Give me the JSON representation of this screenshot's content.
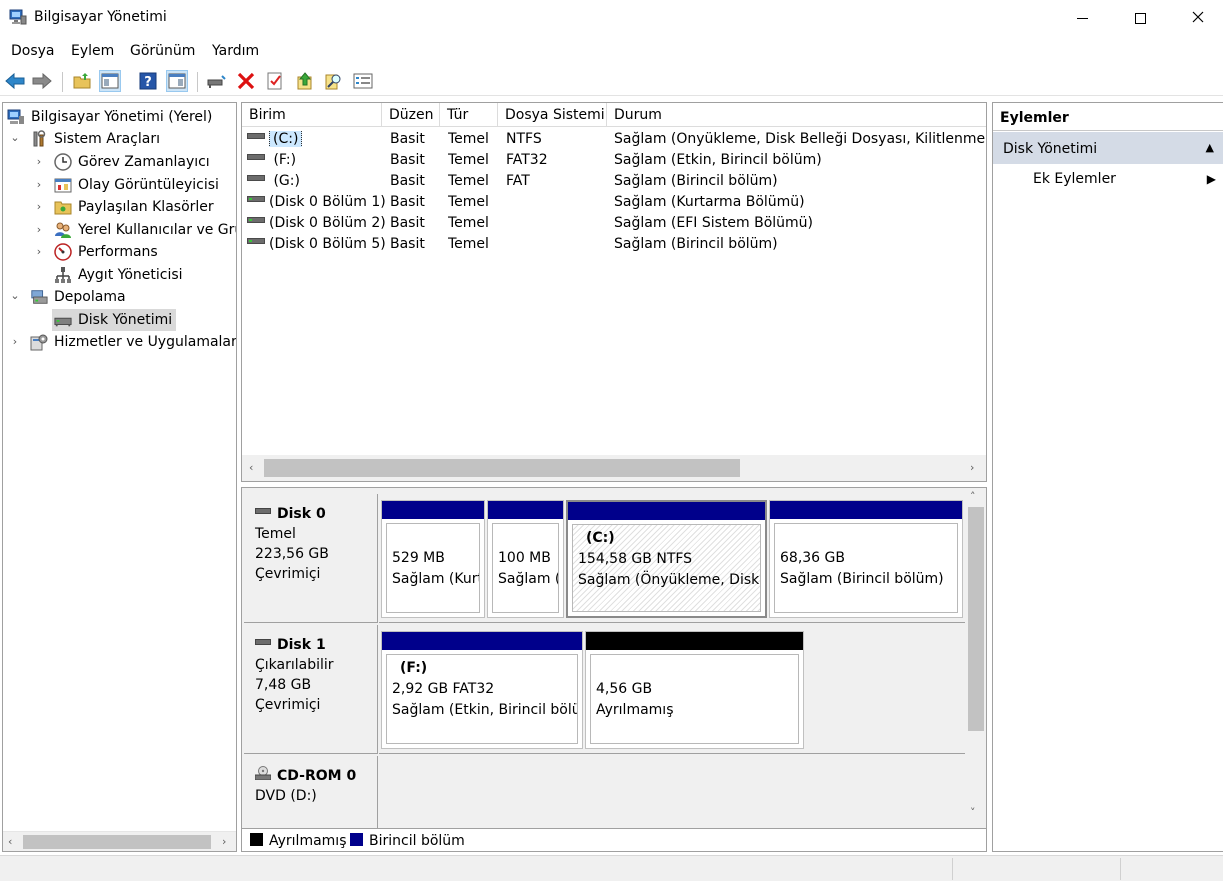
{
  "window": {
    "title": "Bilgisayar Yönetimi",
    "minimize": "—",
    "maximize": "☐",
    "close": "✕"
  },
  "menu": [
    "Dosya",
    "Eylem",
    "Görünüm",
    "Yardım"
  ],
  "tree": {
    "root": "Bilgisayar Yönetimi (Yerel)",
    "system_tools": "Sistem Araçları",
    "task_scheduler": "Görev Zamanlayıcı",
    "event_viewer": "Olay Görüntüleyicisi",
    "shared_folders": "Paylaşılan Klasörler",
    "local_users": "Yerel Kullanıcılar ve Gruplar",
    "performance": "Performans",
    "device_manager": "Aygıt Yöneticisi",
    "storage": "Depolama",
    "disk_management": "Disk Yönetimi",
    "services": "Hizmetler ve Uygulamalar"
  },
  "list": {
    "columns": [
      "Birim",
      "Düzen",
      "Tür",
      "Dosya Sistemi",
      "Durum"
    ],
    "rows": [
      {
        "birim": "(C:)",
        "duzen": "Basit",
        "tur": "Temel",
        "fs": "NTFS",
        "durum": "Sağlam (Önyükleme, Disk Belleği Dosyası, Kilitlenme Bilgi Dökümü, Birincil bölüm)"
      },
      {
        "birim": "(F:)",
        "duzen": "Basit",
        "tur": "Temel",
        "fs": "FAT32",
        "durum": "Sağlam (Etkin, Birincil bölüm)"
      },
      {
        "birim": "(G:)",
        "duzen": "Basit",
        "tur": "Temel",
        "fs": "FAT",
        "durum": "Sağlam (Birincil bölüm)"
      },
      {
        "birim": "(Disk 0 Bölüm 1)",
        "duzen": "Basit",
        "tur": "Temel",
        "fs": "",
        "durum": "Sağlam (Kurtarma Bölümü)"
      },
      {
        "birim": "(Disk 0 Bölüm 2)",
        "duzen": "Basit",
        "tur": "Temel",
        "fs": "",
        "durum": "Sağlam (EFI Sistem Bölümü)"
      },
      {
        "birim": "(Disk 0 Bölüm 5)",
        "duzen": "Basit",
        "tur": "Temel",
        "fs": "",
        "durum": "Sağlam (Birincil bölüm)"
      }
    ]
  },
  "disks": {
    "disk0": {
      "name": "Disk 0",
      "type": "Temel",
      "size": "223,56 GB",
      "status": "Çevrimiçi",
      "parts": [
        {
          "name": "",
          "size": "529 MB",
          "status": "Sağlam (Kurtarma Bölümü)"
        },
        {
          "name": "",
          "size": "100 MB",
          "status": "Sağlam (EFI Sistem Bölümü)"
        },
        {
          "name": "(C:)",
          "size": "154,58 GB NTFS",
          "status": "Sağlam (Önyükleme, Disk Belleği Dosyası)"
        },
        {
          "name": "",
          "size": "68,36 GB",
          "status": "Sağlam (Birincil bölüm)"
        }
      ]
    },
    "disk1": {
      "name": "Disk 1",
      "type": "Çıkarılabilir",
      "size": "7,48 GB",
      "status": "Çevrimiçi",
      "parts": [
        {
          "name": "(F:)",
          "size": "2,92 GB FAT32",
          "status": "Sağlam (Etkin, Birincil bölüm)"
        },
        {
          "name": "",
          "size": "4,56 GB",
          "status": "Ayrılmamış"
        }
      ]
    },
    "cdrom0": {
      "name": "CD-ROM 0",
      "type": "DVD (D:)"
    }
  },
  "legend": {
    "unallocated": "Ayrılmamış",
    "primary": "Birincil bölüm"
  },
  "actions": {
    "header": "Eylemler",
    "group": "Disk Yönetimi",
    "item": "Ek Eylemler"
  },
  "colors": {
    "primary_partition": "#00008b",
    "unallocated": "#000000",
    "selection": "#cce8ff",
    "actions_group": "#d4dbe6"
  }
}
